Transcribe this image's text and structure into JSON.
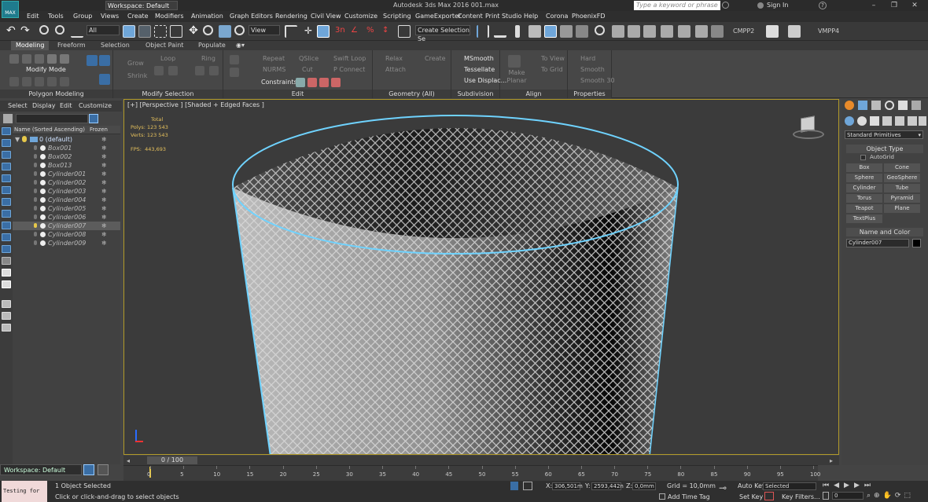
{
  "app": {
    "title": "Autodesk 3ds Max 2016    001.max",
    "logo_text": "MAX",
    "workspace": "Workspace: Default",
    "search_placeholder": "Type a keyword or phrase",
    "sign_in": "Sign In",
    "window_buttons": [
      "–",
      "❐",
      "✕"
    ]
  },
  "menu": [
    "Edit",
    "Tools",
    "Group",
    "Views",
    "Create",
    "Modifiers",
    "Animation",
    "Graph Editors",
    "Rendering",
    "Civil View",
    "Customize",
    "Scripting",
    "GameExporter",
    "Content",
    "Print Studio",
    "Help",
    "Corona",
    "PhoenixFD"
  ],
  "toolbar": {
    "selection_filter": "All",
    "ref_coord": "View",
    "named_selection": "Create Selection Se",
    "cmpp2": "CMPP2",
    "vmpp4": "VMPP4"
  },
  "ribbon": {
    "tabs": [
      "Modeling",
      "Freeform",
      "Selection",
      "Object Paint",
      "Populate"
    ],
    "active_tab": "Modeling",
    "modify_mode": "Modify Mode",
    "panels": [
      "Polygon Modeling",
      "Modify Selection",
      "Edit",
      "Geometry (All)",
      "Subdivision",
      "Align",
      "Properties"
    ],
    "modify_sel": [
      "Grow",
      "Shrink",
      "Loop",
      "Ring"
    ],
    "edit": [
      "Repeat",
      "QSlice",
      "Swift Loop",
      "NURMS",
      "Cut",
      "P Connect",
      "Constraints:"
    ],
    "geometry": [
      "Relax",
      "Create",
      "Attach"
    ],
    "subdivision": [
      "MSmooth",
      "Tessellate",
      "Use Displac..."
    ],
    "align": [
      "Make Planar",
      "To View",
      "To Grid"
    ],
    "properties": [
      "Hard",
      "Smooth",
      "Smooth 30"
    ]
  },
  "scene_explorer": {
    "menu": [
      "Select",
      "Display",
      "Edit",
      "Customize"
    ],
    "col_name": "Name (Sorted Ascending)",
    "col_frozen": "Frozen",
    "layer": "0 (default)",
    "objects": [
      "Box001",
      "Box002",
      "Box013",
      "Cylinder001",
      "Cylinder002",
      "Cylinder003",
      "Cylinder004",
      "Cylinder005",
      "Cylinder006",
      "Cylinder007",
      "Cylinder008",
      "Cylinder009"
    ],
    "selected": "Cylinder007"
  },
  "viewport": {
    "label": "[+] [Perspective ] [Shaded + Edged Faces ]",
    "stats_total": "Total",
    "polys_label": "Polys:",
    "polys": "123 543",
    "verts_label": "Verts:",
    "verts": "123 543",
    "fps_label": "FPS:",
    "fps": "443,693"
  },
  "command_panel": {
    "category": "Standard Primitives",
    "object_type": "Object Type",
    "autogrid": "AutoGrid",
    "buttons": [
      "Box",
      "Cone",
      "Sphere",
      "GeoSphere",
      "Cylinder",
      "Tube",
      "Torus",
      "Pyramid",
      "Teapot",
      "Plane",
      "TextPlus"
    ],
    "name_color": "Name and Color",
    "object_name": "Cylinder007"
  },
  "timeline": {
    "frame": "0 / 100",
    "ticks": [
      "0",
      "5",
      "10",
      "15",
      "20",
      "25",
      "30",
      "35",
      "40",
      "45",
      "50",
      "55",
      "60",
      "65",
      "70",
      "75",
      "80",
      "85",
      "90",
      "95",
      "100"
    ]
  },
  "status": {
    "listener": "Testing for ",
    "selected": "1 Object Selected",
    "prompt": "Click or click-and-drag to select objects",
    "x_label": "X:",
    "x": "306,501m",
    "y_label": "Y:",
    "y": "2593,442n",
    "z_label": "Z:",
    "z": "0,0mm",
    "grid": "Grid = 10,0mm",
    "add_time_tag": "Add Time Tag",
    "auto_key": "Auto Key",
    "set_key": "Set Key",
    "key_mode": "Selected",
    "key_filters": "Key Filters...",
    "current_frame": "0"
  }
}
